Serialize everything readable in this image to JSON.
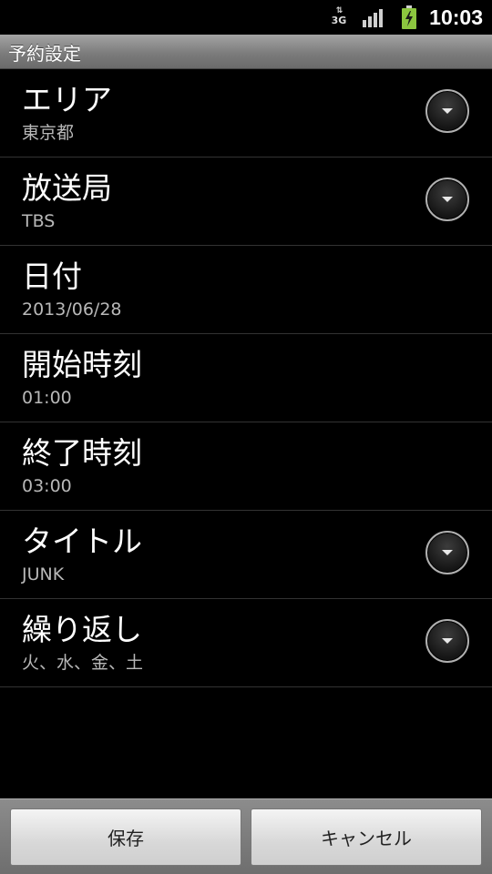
{
  "status_bar": {
    "network": "3G",
    "time": "10:03",
    "battery_color": "#8cc63f"
  },
  "title_bar": {
    "title": "予約設定"
  },
  "settings": [
    {
      "label": "エリア",
      "value": "東京都",
      "has_dropdown": true
    },
    {
      "label": "放送局",
      "value": "TBS",
      "has_dropdown": true
    },
    {
      "label": "日付",
      "value": "2013/06/28",
      "has_dropdown": false
    },
    {
      "label": "開始時刻",
      "value": "01:00",
      "has_dropdown": false
    },
    {
      "label": "終了時刻",
      "value": "03:00",
      "has_dropdown": false
    },
    {
      "label": "タイトル",
      "value": "JUNK",
      "has_dropdown": true
    },
    {
      "label": "繰り返し",
      "value": "火、水、金、土",
      "has_dropdown": true
    }
  ],
  "buttons": {
    "save_label": "保存",
    "cancel_label": "キャンセル"
  }
}
